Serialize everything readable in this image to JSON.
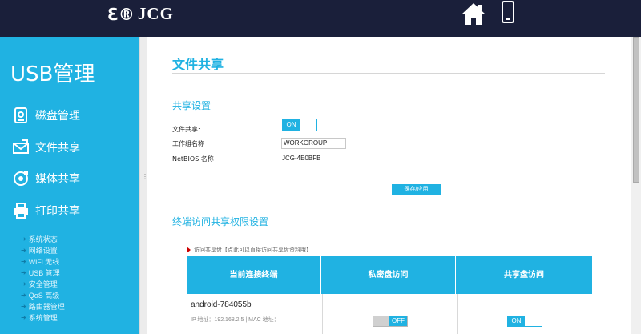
{
  "header": {
    "logo_mark": "Ɛ®",
    "logo_name": "JCG",
    "home_icon": "home-icon",
    "device_icon": "mobile-phone-icon"
  },
  "sidebar": {
    "title": "USB管理",
    "items": [
      {
        "label": "磁盘管理",
        "icon": "disk-icon"
      },
      {
        "label": "文件共享",
        "icon": "folder-share-icon"
      },
      {
        "label": "媒体共享",
        "icon": "media-share-icon"
      },
      {
        "label": "打印共享",
        "icon": "printer-icon"
      }
    ],
    "sub_items": [
      "系统状态",
      "网络设置",
      "WiFi 无线",
      "USB 管理",
      "安全管理",
      "QoS 高级",
      "路由器管理",
      "系统管理"
    ]
  },
  "main": {
    "title": "文件共享",
    "settings_section": "共享设置",
    "file_share_label": "文件共享:",
    "file_share_state": "ON",
    "workgroup_label": "工作组名称",
    "workgroup_value": "WORKGROUP",
    "netbios_label": "NetBIOS 名称",
    "netbios_value": "JCG-4E0BFB",
    "save_button": "保存/应用",
    "access_section": "终端访问共享权限设置",
    "hint": "访问共享盘【点此可以直接访问共享盘资料哦】",
    "table": {
      "headers": [
        "当前连接终端",
        "私密盘访问",
        "共享盘访问"
      ],
      "rows": [
        {
          "device": "android-784055b",
          "info": "IP 地址：192.168.2.5 | MAC 地址：",
          "private_access": "OFF",
          "shared_access": "ON"
        }
      ]
    }
  },
  "colors": {
    "accent": "#20b2e2",
    "header_bg": "#1a1f3a"
  }
}
